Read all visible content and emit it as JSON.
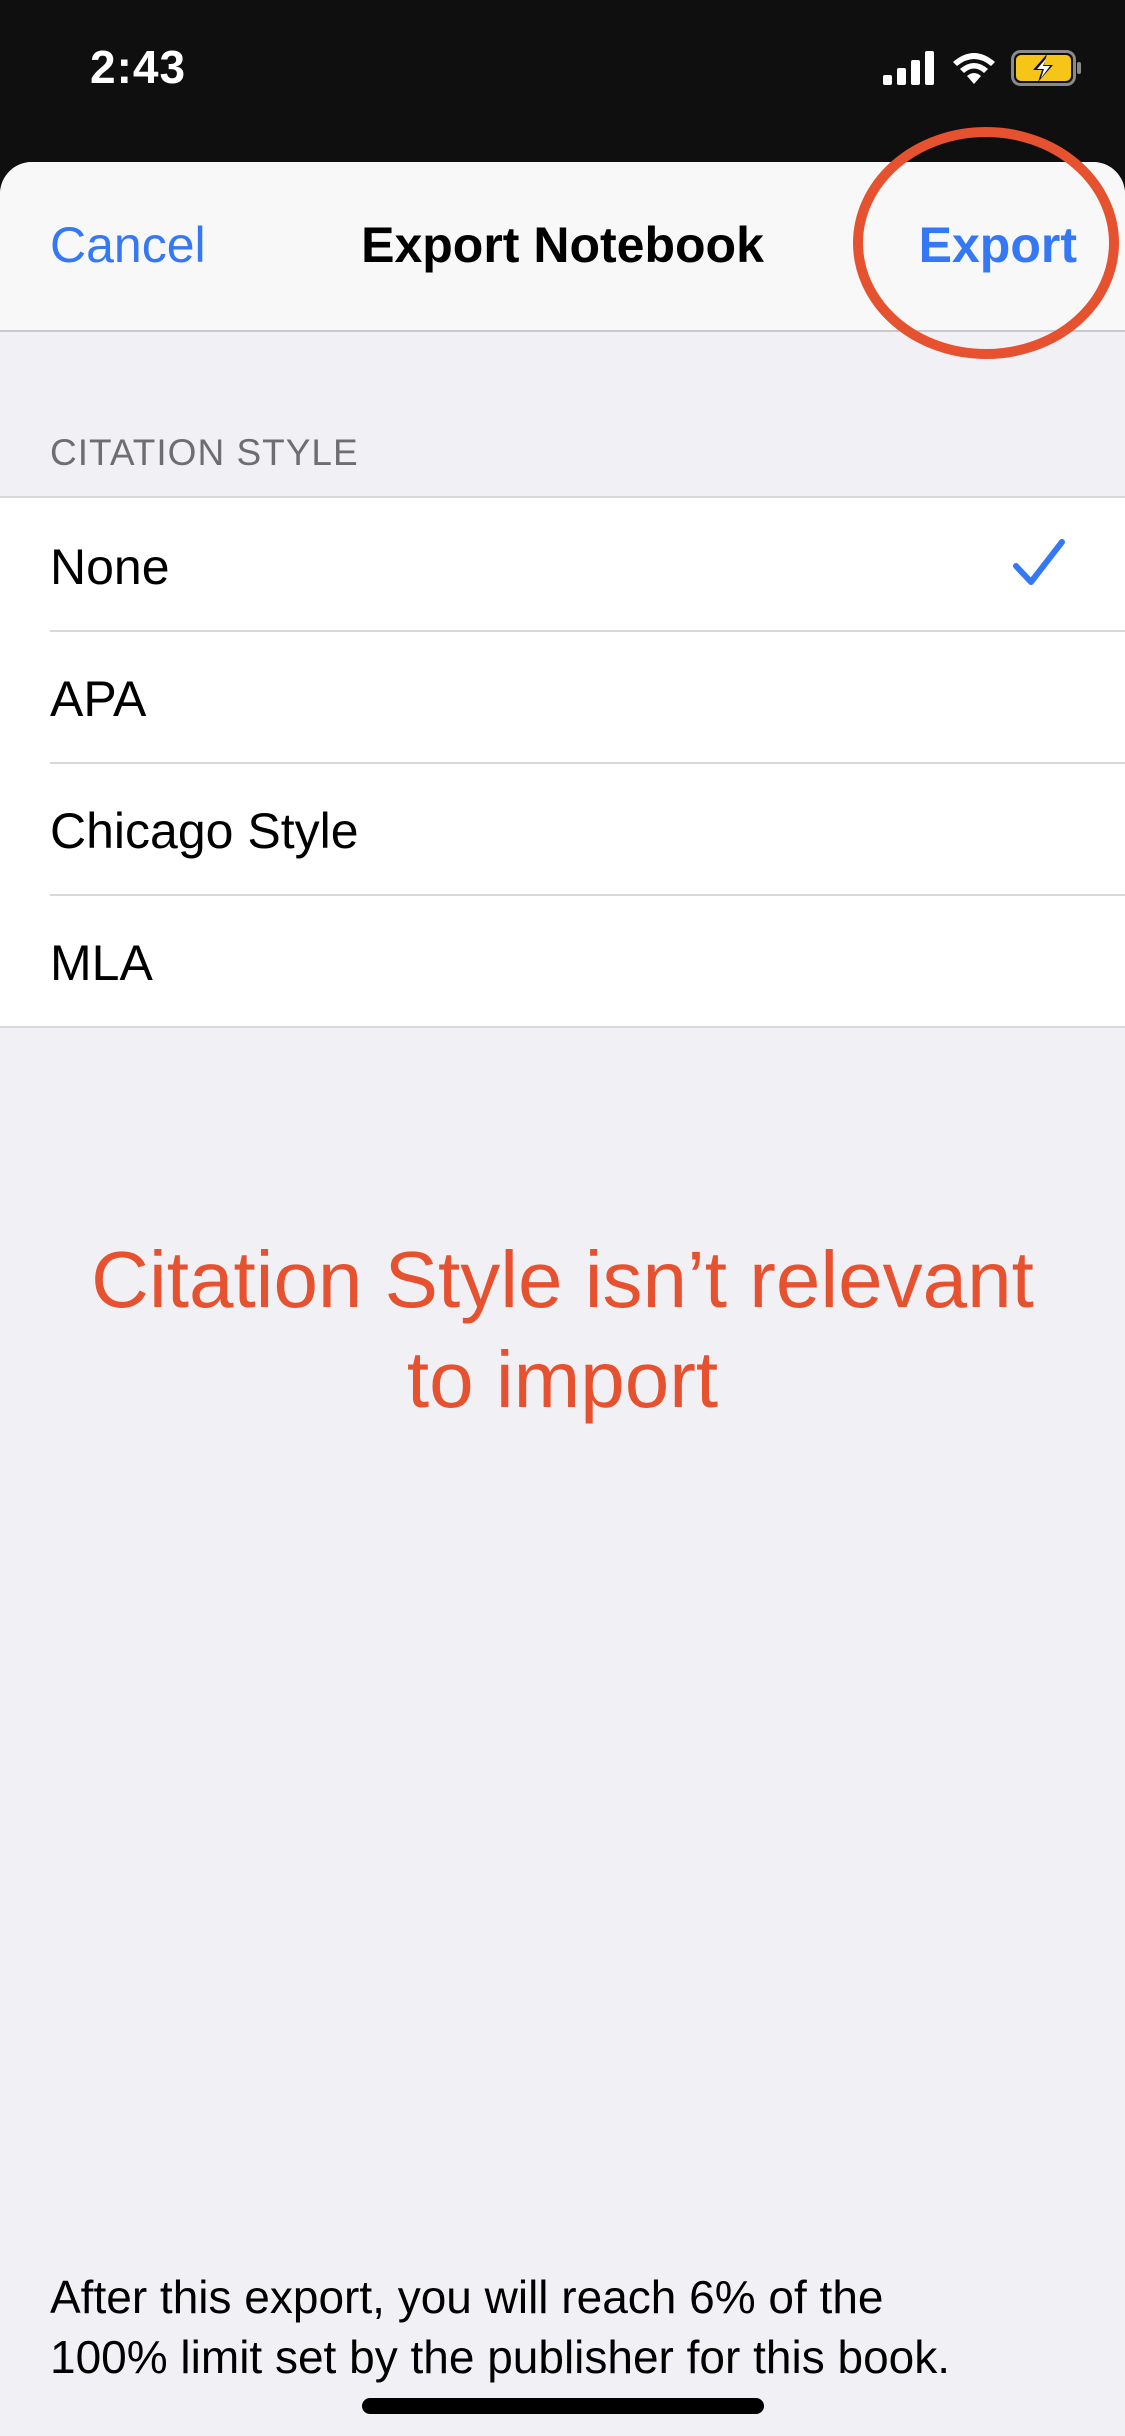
{
  "status_bar": {
    "time": "2:43",
    "icons": [
      "signal-icon",
      "wifi-icon",
      "battery-charging-icon"
    ],
    "battery_color": "#f5c518"
  },
  "nav": {
    "cancel_label": "Cancel",
    "title": "Export Notebook",
    "export_label": "Export"
  },
  "section": {
    "header": "CITATION STYLE",
    "options": [
      {
        "label": "None",
        "selected": true
      },
      {
        "label": "APA",
        "selected": false
      },
      {
        "label": "Chicago Style",
        "selected": false
      },
      {
        "label": "MLA",
        "selected": false
      }
    ]
  },
  "annotation": {
    "line1": "Citation Style isn’t relevant",
    "line2": "to import",
    "color": "#e6512f"
  },
  "footer": {
    "line1": "After this export, you will reach 6% of the",
    "line2": "100% limit set by the publisher for this book."
  },
  "colors": {
    "accent": "#3478f6",
    "annotation": "#e6512f"
  }
}
